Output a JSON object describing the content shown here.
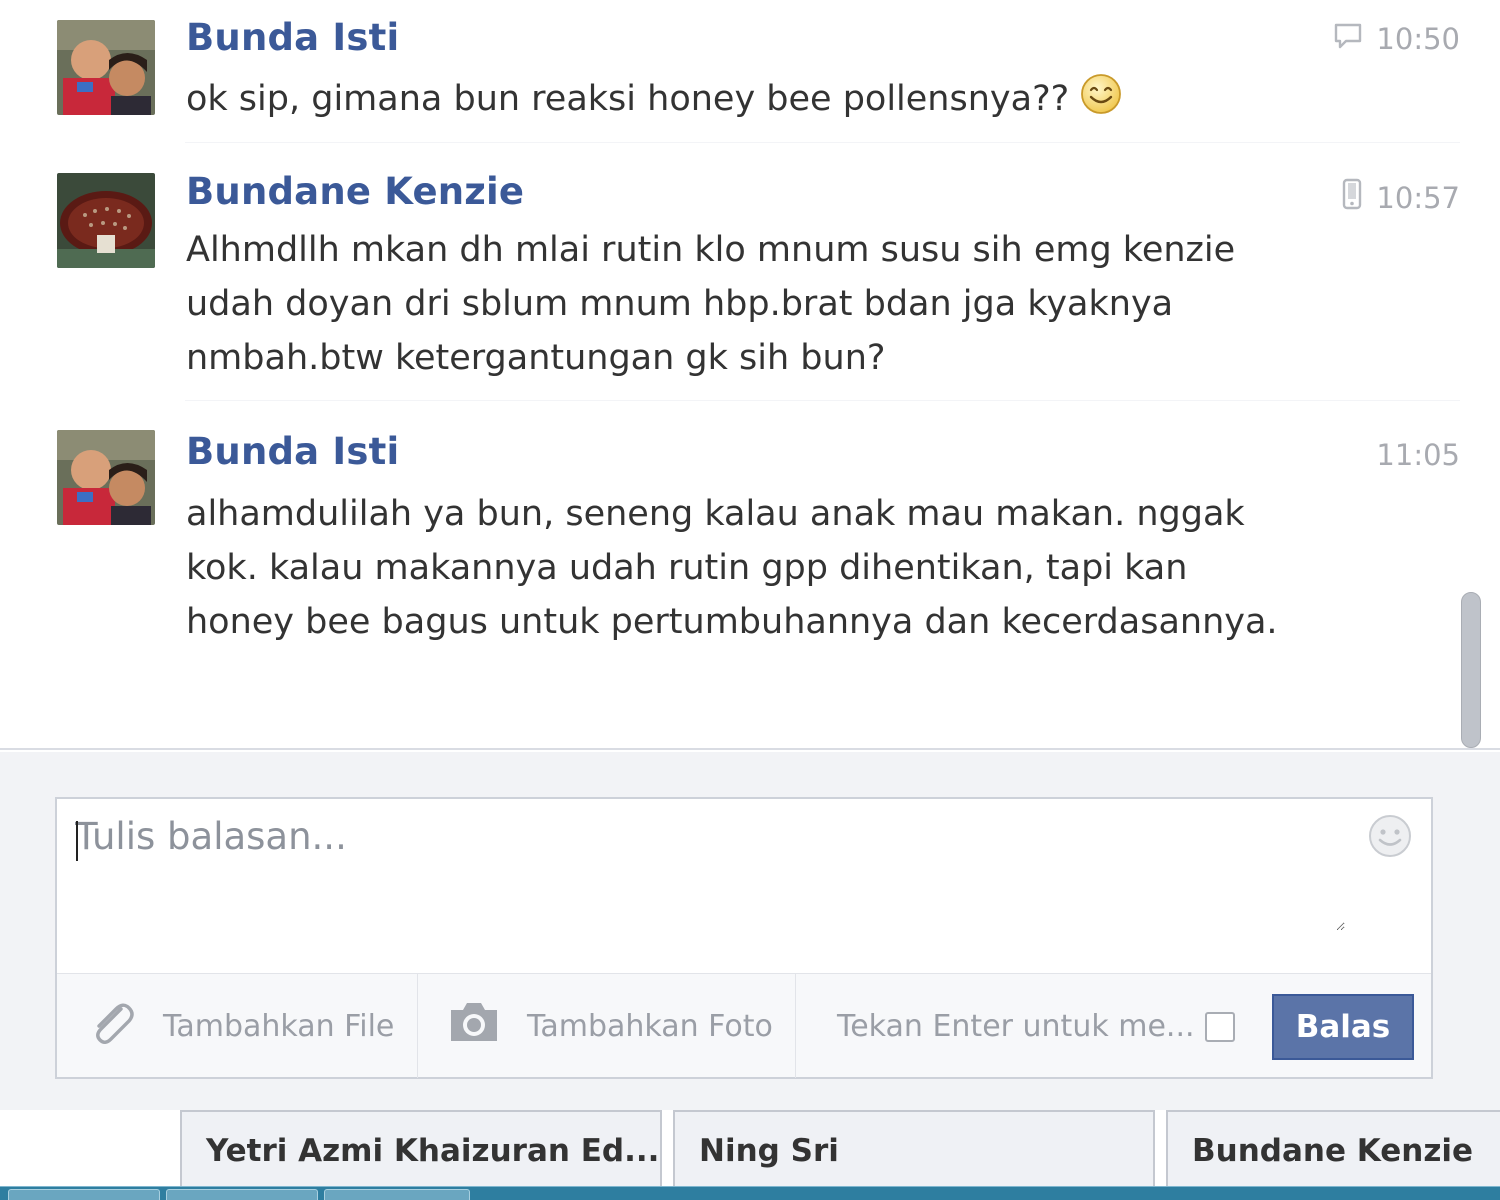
{
  "thread": {
    "messages": [
      {
        "sender": "Bunda Isti",
        "time": "10:50",
        "time_icon": "speech-bubble-icon",
        "lines": [
          "ok sip, gimana bun reaksi honey bee pollensnya??"
        ],
        "emoji": "smiley-icon"
      },
      {
        "sender": "Bundane Kenzie",
        "time": "10:57",
        "time_icon": "mobile-phone-icon",
        "lines": [
          "Alhmdllh mkan dh mlai rutin klo mnum susu sih emg kenzie",
          "udah doyan dri sblum mnum hbp.brat bdan jga kyaknya",
          "nmbah.btw ketergantungan gk sih bun?"
        ]
      },
      {
        "sender": "Bunda Isti",
        "time": "11:05",
        "lines": [
          "alhamdulilah ya bun, seneng kalau anak mau makan. nggak",
          "kok. kalau makannya udah rutin gpp dihentikan, tapi kan",
          "honey bee bagus untuk pertumbuhannya dan kecerdasannya."
        ]
      }
    ]
  },
  "composer": {
    "placeholder": "Tulis balasan...",
    "add_file_label": "Tambahkan File",
    "add_photo_label": "Tambahkan Foto",
    "enter_label": "Tekan Enter untuk me...",
    "enter_checked": false,
    "reply_label": "Balas"
  },
  "chat_tabs": [
    "Yetri Azmi Khaizuran Ed...",
    "Ning Sri",
    "Bundane Kenzie"
  ],
  "colors": {
    "name_blue": "#3b5998",
    "button_blue": "#5b74a8",
    "muted_text": "#9a9ea6"
  }
}
